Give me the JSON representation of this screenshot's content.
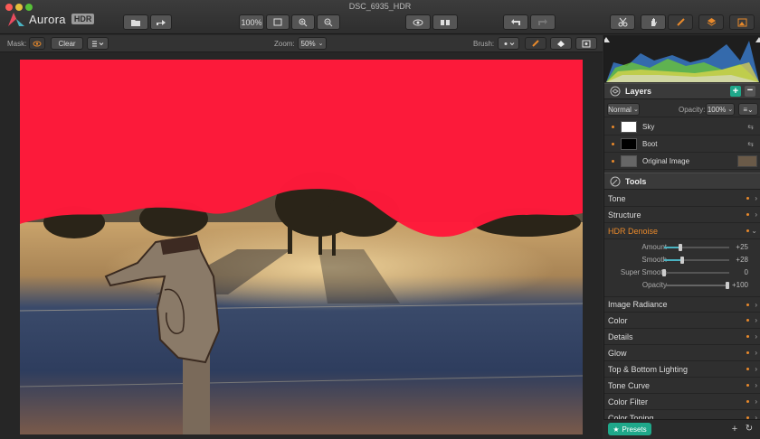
{
  "window": {
    "title": "DSC_6935_HDR"
  },
  "app": {
    "name": "Aurora",
    "badge": "HDR"
  },
  "toolbar": {
    "zoom_percent": "100%"
  },
  "options": {
    "mask_label": "Mask:",
    "clear_label": "Clear",
    "zoom_label": "Zoom:",
    "zoom_value": "50%",
    "brush_label": "Brush:"
  },
  "layers": {
    "title": "Layers",
    "blend_mode": "Normal",
    "opacity_label": "Opacity:",
    "opacity_value": "100%",
    "items": [
      {
        "name": "Sky"
      },
      {
        "name": "Boot"
      },
      {
        "name": "Original Image"
      }
    ]
  },
  "tools": {
    "title": "Tools",
    "items_top": [
      {
        "label": "Tone"
      },
      {
        "label": "Structure"
      }
    ],
    "active": {
      "label": "HDR Denoise",
      "sliders": [
        {
          "label": "Amount",
          "display": "+25",
          "value": 25
        },
        {
          "label": "Smooth",
          "display": "+28",
          "value": 28
        },
        {
          "label": "Super Smooth",
          "display": "0",
          "value": 0
        },
        {
          "label": "Opacity",
          "display": "+100",
          "value": 100
        }
      ]
    },
    "items_bottom": [
      {
        "label": "Image Radiance"
      },
      {
        "label": "Color"
      },
      {
        "label": "Details"
      },
      {
        "label": "Glow"
      },
      {
        "label": "Top & Bottom Lighting"
      },
      {
        "label": "Tone Curve"
      },
      {
        "label": "Color Filter"
      },
      {
        "label": "Color Toning"
      }
    ]
  },
  "footer": {
    "presets_label": "Presets"
  },
  "colors": {
    "accent": "#e8892b",
    "teal": "#1fa88a",
    "mask": "#ff1a3a",
    "plus": "#1fa88a"
  }
}
